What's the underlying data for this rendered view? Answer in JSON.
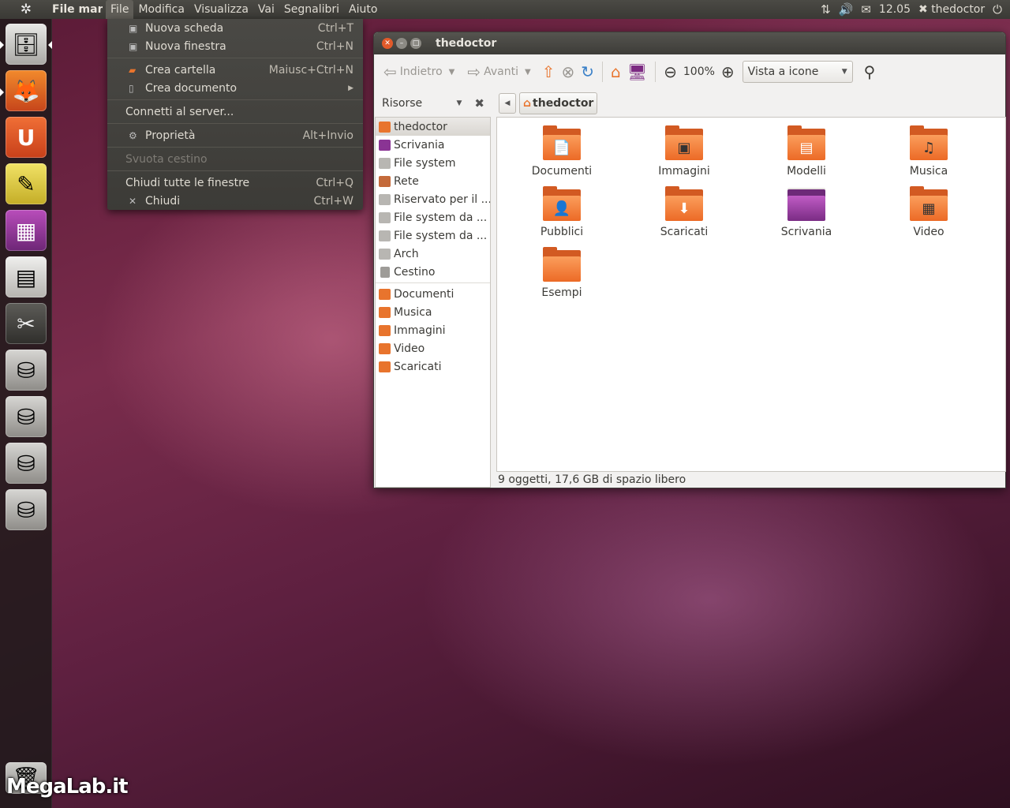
{
  "top_panel": {
    "app_name": "File man",
    "menus": [
      "File",
      "Modifica",
      "Visualizza",
      "Vai",
      "Segnalibri",
      "Aiuto"
    ],
    "clock": "12.05",
    "user": "thedoctor"
  },
  "launcher": {
    "items": [
      "file-cabinet-icon",
      "firefox-icon",
      "ubuntu-one-icon",
      "text-editor-icon",
      "workspaces-icon",
      "files-icon",
      "scissors-icon",
      "drive-icon",
      "drive-icon",
      "drive-icon",
      "drive-icon",
      "trash-icon"
    ]
  },
  "watermark": "MegaLab.it",
  "file_menu": {
    "items": [
      {
        "label": "Nuova scheda",
        "accel": "Ctrl+T"
      },
      {
        "label": "Nuova finestra",
        "accel": "Ctrl+N"
      },
      {
        "label": "Crea cartella",
        "accel": "Maiusc+Ctrl+N"
      },
      {
        "label": "Crea documento",
        "accel": ""
      },
      {
        "label": "Connetti al server...",
        "accel": ""
      },
      {
        "label": "Proprietà",
        "accel": "Alt+Invio"
      },
      {
        "label": "Svuota cestino",
        "accel": ""
      },
      {
        "label": "Chiudi tutte le finestre",
        "accel": "Ctrl+Q"
      },
      {
        "label": "Chiudi",
        "accel": "Ctrl+W"
      }
    ]
  },
  "window": {
    "title": "thedoctor",
    "toolbar": {
      "back": "Indietro",
      "forward": "Avanti",
      "zoom": "100%",
      "view_mode": "Vista a icone"
    },
    "sidebar_header": "Risorse",
    "breadcrumb": "thedoctor",
    "places": [
      "thedoctor",
      "Scrivania",
      "File system",
      "Rete",
      "Riservato per il ...",
      "File system da ...",
      "File system da ...",
      "Arch",
      "Cestino"
    ],
    "bookmarks": [
      "Documenti",
      "Musica",
      "Immagini",
      "Video",
      "Scaricati"
    ],
    "files": [
      {
        "name": "Documenti",
        "emblem": "📄"
      },
      {
        "name": "Immagini",
        "emblem": "▣"
      },
      {
        "name": "Modelli",
        "emblem": "▤"
      },
      {
        "name": "Musica",
        "emblem": "♫"
      },
      {
        "name": "Pubblici",
        "emblem": "👤"
      },
      {
        "name": "Scaricati",
        "emblem": "⬇"
      },
      {
        "name": "Scrivania",
        "emblem": ""
      },
      {
        "name": "Video",
        "emblem": "▦"
      },
      {
        "name": "Esempi",
        "emblem": ""
      }
    ],
    "status": "9 oggetti, 17,6 GB di spazio libero"
  }
}
